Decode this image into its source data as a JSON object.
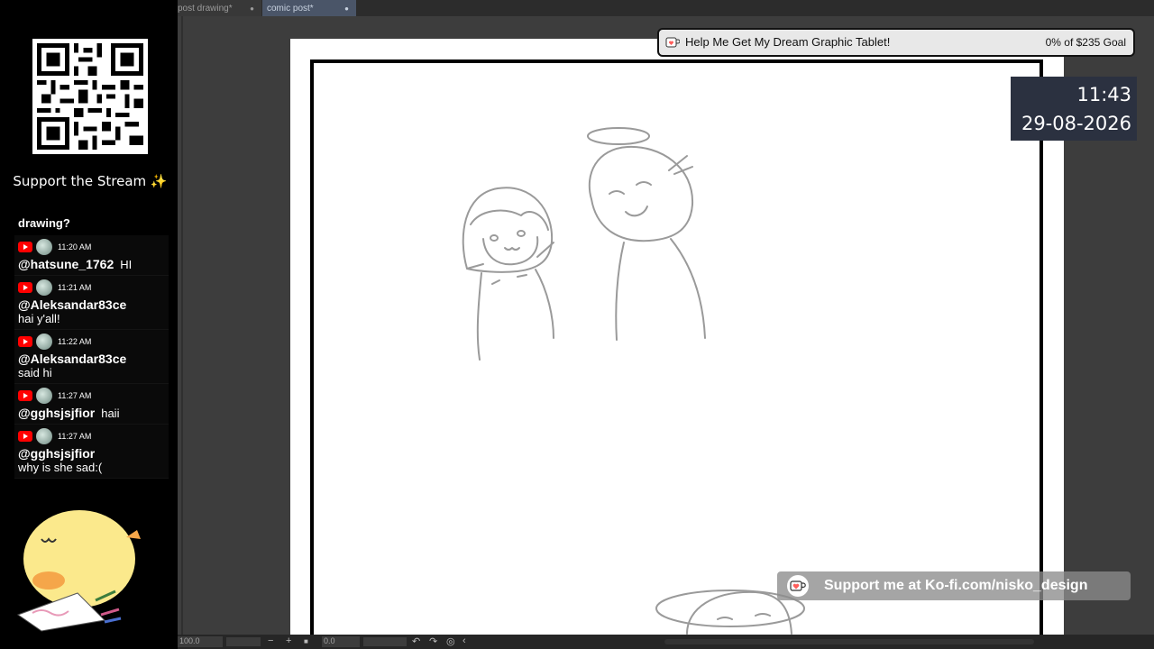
{
  "tabs": [
    {
      "label": "post drawing*",
      "close": "●"
    },
    {
      "label": "comic post*",
      "close": "●"
    }
  ],
  "stream_panel": {
    "support_title": "Support the Stream ✨",
    "chat_preview": "drawing?",
    "messages": [
      {
        "time": "11:20 AM",
        "user": "@hatsune_1762",
        "text": "HI",
        "inline": true
      },
      {
        "time": "11:21 AM",
        "user": "@Aleksandar83ce",
        "text": "hai y'all!",
        "inline": false
      },
      {
        "time": "11:22 AM",
        "user": "@Aleksandar83ce",
        "text": "said hi",
        "inline": false
      },
      {
        "time": "11:27 AM",
        "user": "@gghsjsjfior",
        "text": "haii",
        "inline": true
      },
      {
        "time": "11:27 AM",
        "user": "@gghsjsjfior",
        "text": "why is she sad:(",
        "inline": false
      }
    ]
  },
  "goal": {
    "title": "Help Me Get My Dream Graphic Tablet!",
    "progress": "0% of $235 Goal"
  },
  "clock": {
    "time": "11:43",
    "date": "29-08-2026"
  },
  "kofi": {
    "text": "Support me at Ko-fi.com/nisko_design"
  },
  "status_bar": {
    "zoom": "100.0",
    "rotation": "0.0",
    "minus": "−",
    "plus": "+"
  },
  "colors": {
    "goal_bg": "#e8e8e8",
    "clock_bg": "#2b3140",
    "youtube_red": "#ff0000",
    "kofi_red": "#ff5e5b"
  }
}
